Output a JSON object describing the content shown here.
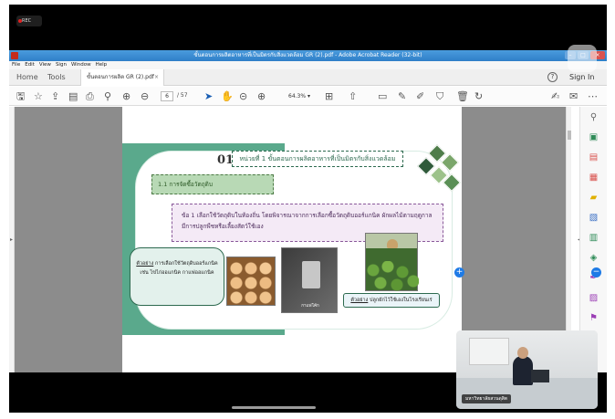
{
  "recording": {
    "label": "REC",
    "color": "#e02020"
  },
  "window": {
    "title": "ขั้นตอนการผลิตอาหารที่เป็นมิตรกับสิ่งแวดล้อม GR (2).pdf - Adobe Acrobat Reader (32-bit)",
    "minimize": "–",
    "maximize": "□",
    "close": "×"
  },
  "menu": [
    "File",
    "Edit",
    "View",
    "Sign",
    "Window",
    "Help"
  ],
  "tabs": {
    "home": "Home",
    "tools": "Tools",
    "document": "ขั้นตอนการผลิต GR (2).pdf",
    "document_close": "×",
    "help": "?",
    "sign_in": "Sign In"
  },
  "toolbar": {
    "current_page": "6",
    "page_total": "/ 57",
    "zoom": "64.3%",
    "zoom_caret": "▾"
  },
  "slide": {
    "chapter_number": "01",
    "chapter_title": "หน่วยที่ 1 ขั้นตอนการผลิตอาหารที่เป็นมิตรกับสิ่งแวดล้อม",
    "section": "1.1 การจัดซื้อวัตถุดิบ",
    "paragraph": "ข้อ 1 เลือกใช้วัตถุดิบในท้องถิ่น โดยพิจารณาจากการเลือกซื้อวัตถุดิบออร์แกนิค ผักผลไม้ตามฤดูกาล มีการปลูกพืชหรือเลี้ยงสัตว์ใช้เอง",
    "example1_label": "ตัวอย่าง",
    "example1_text": " การเลือกใช้วัตถุดิบออร์แกนิค เช่น ไข่ไก่ออแกนิค กาแฟออแกนิค",
    "photo_caption": "กาแฟโค้ก",
    "example2_label": "ตัวอย่าง",
    "example2_text": " ปลูกผักไว้ใช้เองในโรงเรียนเร่",
    "brand_green": "#5aa98c"
  },
  "webcam": {
    "name": "มหาวิทยาลัยสวนดุสิต"
  },
  "icons": {
    "toolbar": [
      "save-icon",
      "bookmark-icon",
      "upload-icon",
      "print-preview-icon",
      "print-icon",
      "search-icon",
      "page-up-icon",
      "page-down-icon",
      "cursor-icon",
      "hand-icon",
      "zoom-out-icon",
      "zoom-in-icon",
      "page-fit-icon",
      "scroll-icon",
      "comment-icon",
      "pen-icon",
      "highlight-icon",
      "stamp-icon",
      "delete-icon",
      "undo-icon",
      "sign-icon",
      "mail-icon",
      "more-icon"
    ],
    "right_panel": [
      "zoom-icon",
      "export-pdf-icon",
      "create-pdf-icon",
      "edit-pdf-icon",
      "comment-icon",
      "combine-icon",
      "organize-icon",
      "compress-icon",
      "fill-sign-icon",
      "protect-icon",
      "more-tools-icon"
    ]
  }
}
